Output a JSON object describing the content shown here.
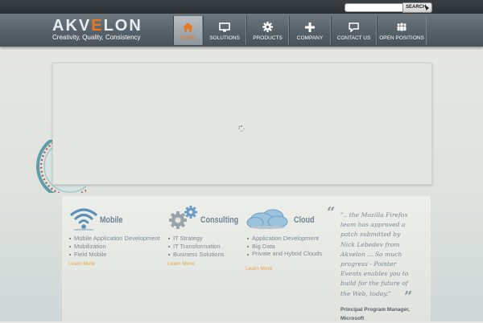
{
  "search": {
    "placeholder": "",
    "button_label": "SEARCH"
  },
  "header": {
    "logo_prefix": "AKV",
    "logo_accent": "E",
    "logo_suffix": "LON",
    "tagline": "Creativity, Quality, Consistency"
  },
  "nav": [
    {
      "label": "HOME",
      "icon": "home-icon",
      "active": true
    },
    {
      "label": "SOLUTIONS",
      "icon": "monitor-icon",
      "active": false
    },
    {
      "label": "PRODUCTS",
      "icon": "gear-icon",
      "active": false
    },
    {
      "label": "COMPANY",
      "icon": "plus-icon",
      "active": false
    },
    {
      "label": "CONTACT US",
      "icon": "speech-bubble-icon",
      "active": false
    },
    {
      "label": "OPEN POSITIONS",
      "icon": "people-icon",
      "active": false
    }
  ],
  "services": [
    {
      "title": "Mobile",
      "icon": "wifi-icon",
      "items": [
        "Mobile Application Development",
        "Mobilization",
        "Field Mobile"
      ],
      "link": "Learn More"
    },
    {
      "title": "Consulting",
      "icon": "gears-icon",
      "items": [
        "IT Strategy",
        "IT Transformation",
        "Business Solutions"
      ],
      "link": "Learn More"
    },
    {
      "title": "Cloud",
      "icon": "cloud-icon",
      "items": [
        "Application Development",
        "Big Data",
        "Private and Hybrid Clouds"
      ],
      "link": "Learn More"
    }
  ],
  "testimonial": {
    "quote": "\".. the Mozilla Firefox team has approved a patch submitted by Nick Lebedev from Akvelon ... So much progress - Pointer Events enables you to build for the future of the Web, today.\"",
    "author": "Principal Program Manager, Microsoft"
  },
  "colors": {
    "accent": "#e87722",
    "header": "#5a656e",
    "service_title": "#6e8296",
    "link": "#e8a64a"
  }
}
